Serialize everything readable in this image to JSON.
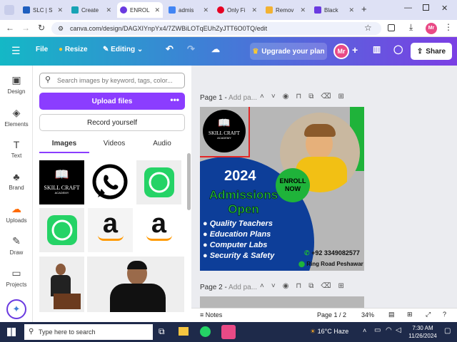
{
  "browser": {
    "tabs": [
      {
        "label": "SLC | S",
        "color": "#1f5fbf"
      },
      {
        "label": "Create",
        "color": "#18a3b5"
      },
      {
        "label": "ENROL",
        "color": "#6a3ae0"
      },
      {
        "label": "admis",
        "color": "#4285f4"
      },
      {
        "label": "Only Fi",
        "color": "#e60023"
      },
      {
        "label": "Remov",
        "color": "#f2b233"
      },
      {
        "label": "Black",
        "color": "#6a3ae0"
      }
    ],
    "url": "canva.com/design/DAGXIYnpYx4/7ZWBiLOTqEUhZyJTT6O0TQ/edit",
    "profile_initials": "Mr"
  },
  "canva_header": {
    "file_label": "File",
    "resize_label": "Resize",
    "editing_label": "Editing",
    "upgrade_label": "Upgrade your plan",
    "avatar_initials": "Mr",
    "share_label": "Share"
  },
  "left_rail": [
    {
      "label": "Design",
      "icon": "design-icon"
    },
    {
      "label": "Elements",
      "icon": "elements-icon"
    },
    {
      "label": "Text",
      "icon": "text-icon"
    },
    {
      "label": "Brand",
      "icon": "brand-icon"
    },
    {
      "label": "Uploads",
      "icon": "uploads-icon"
    },
    {
      "label": "Draw",
      "icon": "draw-icon"
    },
    {
      "label": "Projects",
      "icon": "projects-icon"
    }
  ],
  "panel": {
    "search_placeholder": "Search images by keyword, tags, color...",
    "upload_label": "Upload files",
    "record_label": "Record yourself",
    "tabs": [
      "Images",
      "Videos",
      "Audio"
    ]
  },
  "thumbs": {
    "logo_text": "SKILL CRAFT",
    "logo_sub": "ACADEMY"
  },
  "editor": {
    "page1_label": "Page 1 -",
    "page1_placeholder": "Add pa...",
    "page2_label": "Page 2 -",
    "page2_placeholder": "Add pa...",
    "notes_label": "Notes",
    "page_count": "Page 1 / 2",
    "zoom": "34%"
  },
  "design": {
    "logo_text": "SKILL CRAFT",
    "logo_sub": "ACADEMY",
    "year": "2024",
    "enroll_line1": "ENROLL",
    "enroll_line2": "NOW",
    "headline1": "Admissions",
    "headline2": "Open",
    "bullets": [
      "Quality Teachers",
      "Education Plans",
      "Computer Labs",
      "Security & Safety"
    ],
    "phone": "+92 3349082577",
    "address": "Ring Road Peshawar",
    "colors": {
      "green": "#1fb33a",
      "blue": "#0d3e99",
      "yellow": "#f4e21c"
    }
  },
  "taskbar": {
    "search_placeholder": "Type here to search",
    "weather": "16°C  Haze",
    "time": "7:30 AM",
    "date": "11/26/2024"
  }
}
